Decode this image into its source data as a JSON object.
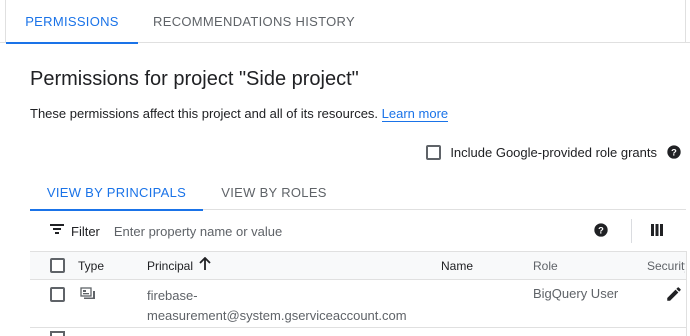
{
  "top_tabs": [
    {
      "label": "PERMISSIONS",
      "active": true
    },
    {
      "label": "RECOMMENDATIONS HISTORY",
      "active": false
    }
  ],
  "page": {
    "title": "Permissions for project \"Side project\"",
    "description": "These permissions affect this project and all of its resources.",
    "learn_more": "Learn more",
    "include_label": "Include Google-provided role grants"
  },
  "sub_tabs": [
    {
      "label": "VIEW BY PRINCIPALS",
      "active": true
    },
    {
      "label": "VIEW BY ROLES",
      "active": false
    }
  ],
  "filter": {
    "label": "Filter",
    "placeholder": "Enter property name or value"
  },
  "table": {
    "columns": {
      "type": "Type",
      "principal": "Principal",
      "name": "Name",
      "role": "Role",
      "security": "Security"
    },
    "rows": [
      {
        "type_icon": "service-account-icon",
        "principal_line1": "firebase-",
        "principal_line2": "measurement@system.gserviceaccount.com",
        "name": "",
        "role": "BigQuery User"
      }
    ]
  },
  "colors": {
    "accent": "#1a73e8",
    "text": "#202124",
    "muted": "#5f6368",
    "border": "#e0e0e0"
  }
}
